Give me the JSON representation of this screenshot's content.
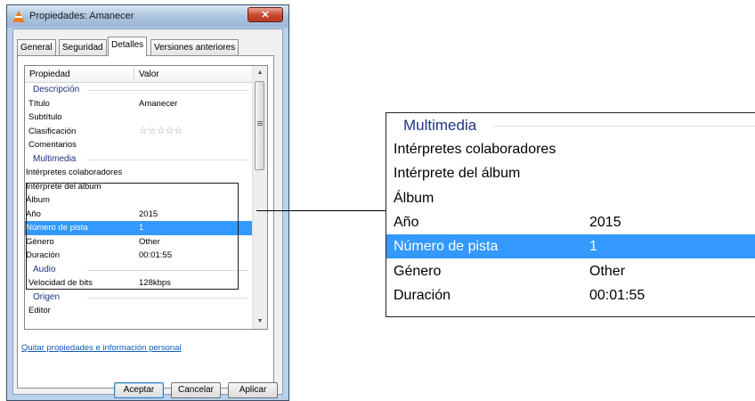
{
  "window": {
    "title": "Propiedades: Amanecer",
    "close_glyph": "✕",
    "app_icon": "vlc-cone-icon"
  },
  "tabs": [
    "General",
    "Seguridad",
    "Detalles",
    "Versiones anteriores"
  ],
  "active_tab": "Detalles",
  "list": {
    "columns": {
      "property": "Propiedad",
      "value": "Valor"
    },
    "rating_stars": "☆☆☆☆☆",
    "rows": [
      {
        "type": "group",
        "label": "Descripción"
      },
      {
        "label": "Título",
        "value": "Amanecer"
      },
      {
        "label": "Subtítulo",
        "value": ""
      },
      {
        "label": "Clasificación",
        "value": ""
      },
      {
        "label": "Comentarios",
        "value": ""
      },
      {
        "type": "group",
        "label": "Multimedia"
      },
      {
        "label": "Intérpretes colaboradores",
        "value": ""
      },
      {
        "label": "Intérprete del álbum",
        "value": ""
      },
      {
        "label": "Álbum",
        "value": ""
      },
      {
        "label": "Año",
        "value": "2015"
      },
      {
        "label": "Número de pista",
        "value": "1",
        "selected": true
      },
      {
        "label": "Género",
        "value": "Other"
      },
      {
        "label": "Duración",
        "value": "00:01:55"
      },
      {
        "type": "group",
        "label": "Audio"
      },
      {
        "label": "Velocidad de bits",
        "value": "128kbps"
      },
      {
        "type": "group",
        "label": "Origen"
      },
      {
        "label": "Editor",
        "value": ""
      }
    ]
  },
  "remove_link": "Quitar propiedades e información personal",
  "buttons": {
    "ok": "Aceptar",
    "cancel": "Cancelar",
    "apply": "Aplicar"
  },
  "zoom": {
    "group": "Multimedia",
    "rows": [
      {
        "label": "Intérpretes colaboradores",
        "value": ""
      },
      {
        "label": "Intérprete del álbum",
        "value": ""
      },
      {
        "label": "Álbum",
        "value": ""
      },
      {
        "label": "Año",
        "value": "2015"
      },
      {
        "label": "Número de pista",
        "value": "1",
        "selected": true
      },
      {
        "label": "Género",
        "value": "Other"
      },
      {
        "label": "Duración",
        "value": "00:01:55"
      }
    ]
  },
  "colors": {
    "selection": "#3399ff",
    "group_text": "#1e3287",
    "link": "#0b5bbf"
  }
}
